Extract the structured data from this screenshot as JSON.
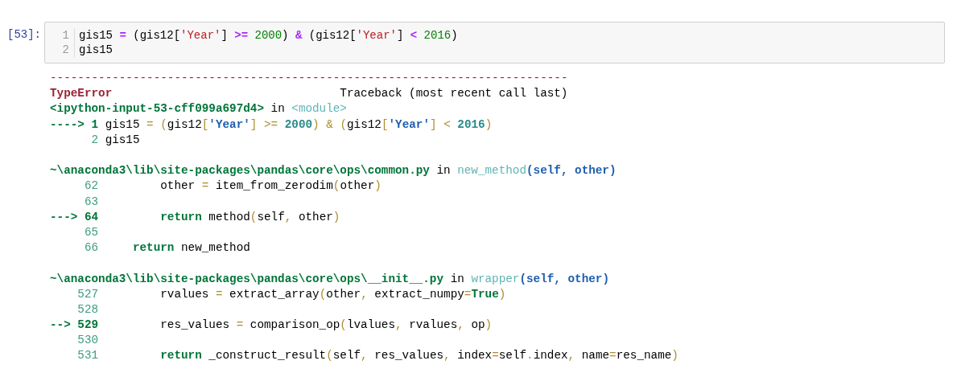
{
  "cell": {
    "prompt": "[53]:",
    "lines": [
      {
        "number": "1",
        "tokens": [
          {
            "text": "gis15 ",
            "kind": "plain"
          },
          {
            "text": "=",
            "kind": "op"
          },
          {
            "text": " (gis12[",
            "kind": "plain"
          },
          {
            "text": "'Year'",
            "kind": "str"
          },
          {
            "text": "] ",
            "kind": "plain"
          },
          {
            "text": ">=",
            "kind": "op"
          },
          {
            "text": " 2000",
            "kind": "num"
          },
          {
            "text": ") ",
            "kind": "plain"
          },
          {
            "text": "&",
            "kind": "op"
          },
          {
            "text": " (gis12[",
            "kind": "plain"
          },
          {
            "text": "'Year'",
            "kind": "str"
          },
          {
            "text": "] ",
            "kind": "plain"
          },
          {
            "text": "<",
            "kind": "op"
          },
          {
            "text": " 2016",
            "kind": "num"
          },
          {
            "text": ")",
            "kind": "plain"
          }
        ]
      },
      {
        "number": "2",
        "tokens": [
          {
            "text": "gis15",
            "kind": "plain"
          }
        ]
      }
    ]
  },
  "output": {
    "rule": "---------------------------------------------------------------------------",
    "error_name": "TypeError",
    "traceback_label": "Traceback (most recent call last)",
    "frames": [
      {
        "file": "<ipython-input-53-cff099a697d4>",
        "in_word": "in",
        "function": "<module>",
        "lines": [
          {
            "marker": "---->",
            "number": "1",
            "current": true,
            "tokens": [
              {
                "text": "gis15 ",
                "kind": "plain"
              },
              {
                "text": "= (",
                "kind": "op"
              },
              {
                "text": "gis12",
                "kind": "plain"
              },
              {
                "text": "[",
                "kind": "op"
              },
              {
                "text": "'Year'",
                "kind": "str"
              },
              {
                "text": "] >= ",
                "kind": "op"
              },
              {
                "text": "2000",
                "kind": "num"
              },
              {
                "text": ") & (",
                "kind": "op"
              },
              {
                "text": "gis12",
                "kind": "plain"
              },
              {
                "text": "[",
                "kind": "op"
              },
              {
                "text": "'Year'",
                "kind": "str"
              },
              {
                "text": "] < ",
                "kind": "op"
              },
              {
                "text": "2016",
                "kind": "num"
              },
              {
                "text": ")",
                "kind": "op"
              }
            ]
          },
          {
            "number": "2",
            "current": false,
            "tokens": [
              {
                "text": "gis15",
                "kind": "plain"
              }
            ]
          }
        ]
      },
      {
        "file": "~\\anaconda3\\lib\\site-packages\\pandas\\core\\ops\\common.py",
        "in_word": "in",
        "function": "new_method",
        "signature": "(self, other)",
        "lines": [
          {
            "number": "62",
            "current": false,
            "tokens": [
              {
                "text": "        other ",
                "kind": "plain"
              },
              {
                "text": "=",
                "kind": "op"
              },
              {
                "text": " item_from_zerodim",
                "kind": "plain"
              },
              {
                "text": "(",
                "kind": "op"
              },
              {
                "text": "other",
                "kind": "plain"
              },
              {
                "text": ")",
                "kind": "op"
              }
            ]
          },
          {
            "number": "63",
            "current": false
          },
          {
            "marker": "--->",
            "number": "64",
            "current": true,
            "tokens": [
              {
                "text": "        return",
                "kind": "kw"
              },
              {
                "text": " method",
                "kind": "plain"
              },
              {
                "text": "(",
                "kind": "op"
              },
              {
                "text": "self",
                "kind": "plain"
              },
              {
                "text": ", ",
                "kind": "op"
              },
              {
                "text": "other",
                "kind": "plain"
              },
              {
                "text": ")",
                "kind": "op"
              }
            ]
          },
          {
            "number": "65",
            "current": false
          },
          {
            "number": "66",
            "current": false,
            "tokens": [
              {
                "text": "    return",
                "kind": "kw"
              },
              {
                "text": " new_method",
                "kind": "plain"
              }
            ]
          }
        ]
      },
      {
        "file": "~\\anaconda3\\lib\\site-packages\\pandas\\core\\ops\\__init__.py",
        "in_word": "in",
        "function": "wrapper",
        "signature": "(self, other)",
        "lines": [
          {
            "number": "527",
            "current": false,
            "tokens": [
              {
                "text": "        rvalues ",
                "kind": "plain"
              },
              {
                "text": "=",
                "kind": "op"
              },
              {
                "text": " extract_array",
                "kind": "plain"
              },
              {
                "text": "(",
                "kind": "op"
              },
              {
                "text": "other",
                "kind": "plain"
              },
              {
                "text": ", ",
                "kind": "op"
              },
              {
                "text": "extract_numpy",
                "kind": "plain"
              },
              {
                "text": "=",
                "kind": "op"
              },
              {
                "text": "True",
                "kind": "kw"
              },
              {
                "text": ")",
                "kind": "op"
              }
            ]
          },
          {
            "number": "528",
            "current": false
          },
          {
            "marker": "-->",
            "number": "529",
            "current": true,
            "tokens": [
              {
                "text": "        res_values ",
                "kind": "plain"
              },
              {
                "text": "=",
                "kind": "op"
              },
              {
                "text": " comparison_op",
                "kind": "plain"
              },
              {
                "text": "(",
                "kind": "op"
              },
              {
                "text": "lvalues",
                "kind": "plain"
              },
              {
                "text": ", ",
                "kind": "op"
              },
              {
                "text": "rvalues",
                "kind": "plain"
              },
              {
                "text": ", ",
                "kind": "op"
              },
              {
                "text": "op",
                "kind": "plain"
              },
              {
                "text": ")",
                "kind": "op"
              }
            ]
          },
          {
            "number": "530",
            "current": false
          },
          {
            "number": "531",
            "current": false,
            "tokens": [
              {
                "text": "        return",
                "kind": "kw"
              },
              {
                "text": " _construct_result",
                "kind": "plain"
              },
              {
                "text": "(",
                "kind": "op"
              },
              {
                "text": "self",
                "kind": "plain"
              },
              {
                "text": ", ",
                "kind": "op"
              },
              {
                "text": "res_values",
                "kind": "plain"
              },
              {
                "text": ", ",
                "kind": "op"
              },
              {
                "text": "index",
                "kind": "plain"
              },
              {
                "text": "=",
                "kind": "op"
              },
              {
                "text": "self",
                "kind": "plain"
              },
              {
                "text": ".",
                "kind": "op"
              },
              {
                "text": "index",
                "kind": "plain"
              },
              {
                "text": ", ",
                "kind": "op"
              },
              {
                "text": "name",
                "kind": "plain"
              },
              {
                "text": "=",
                "kind": "op"
              },
              {
                "text": "res_name",
                "kind": "plain"
              },
              {
                "text": ")",
                "kind": "op"
              }
            ]
          }
        ]
      }
    ]
  }
}
